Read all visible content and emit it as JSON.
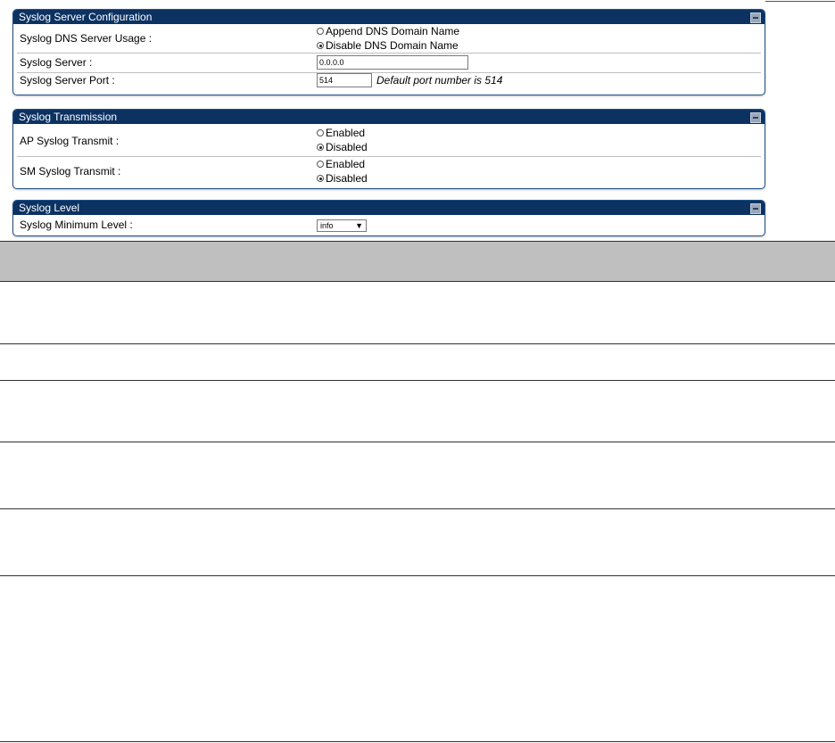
{
  "panels": {
    "server_config": {
      "title": "Syslog Server Configuration",
      "dns_usage": {
        "label": "Syslog DNS Server Usage :",
        "options": [
          "Append DNS Domain Name",
          "Disable DNS Domain Name"
        ],
        "selected": "Disable DNS Domain Name"
      },
      "server": {
        "label": "Syslog Server :",
        "value": "0.0.0.0"
      },
      "port": {
        "label": "Syslog Server Port :",
        "value": "514",
        "hint": "Default port number is 514"
      }
    },
    "transmission": {
      "title": "Syslog Transmission",
      "ap": {
        "label": "AP Syslog Transmit :",
        "options": [
          "Enabled",
          "Disabled"
        ],
        "selected": "Disabled"
      },
      "sm": {
        "label": "SM Syslog Transmit :",
        "options": [
          "Enabled",
          "Disabled"
        ],
        "selected": "Disabled"
      }
    },
    "level": {
      "title": "Syslog Level",
      "min_level": {
        "label": "Syslog Minimum Level :",
        "value": "info"
      }
    }
  },
  "icons": {
    "collapse": "collapse-icon",
    "dropdown": "chevron-down-icon"
  },
  "colors": {
    "panel_header": "#0c3262",
    "panel_border": "#1f4f8a",
    "table_header": "#bfbfbf"
  }
}
